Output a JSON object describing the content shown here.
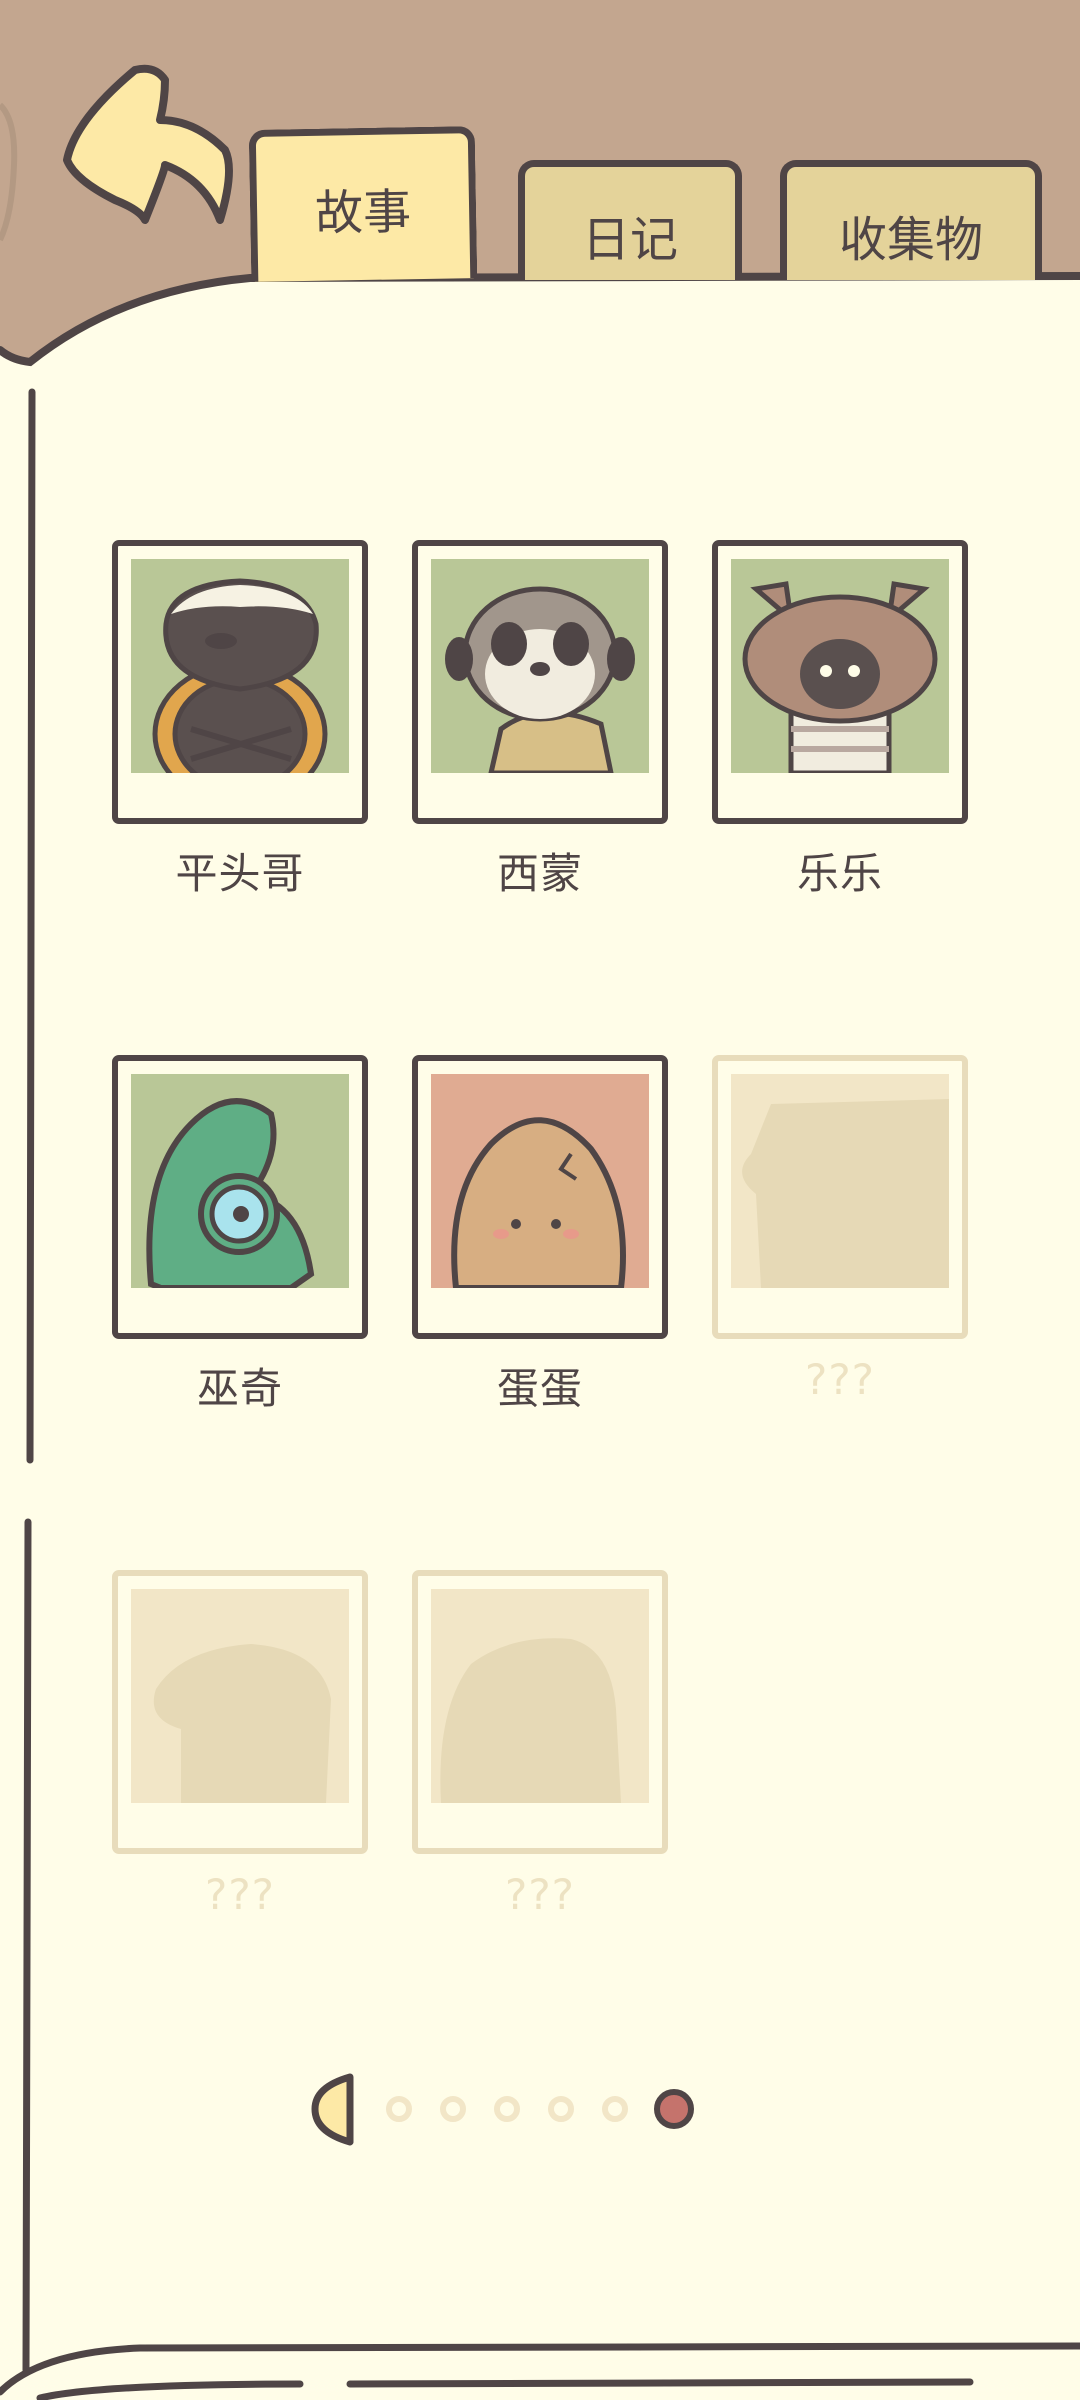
{
  "tabs": [
    {
      "label": "故事",
      "active": true
    },
    {
      "label": "日记",
      "active": false
    },
    {
      "label": "收集物",
      "active": false
    }
  ],
  "characters": [
    {
      "name": "平头哥",
      "unlocked": true,
      "bg": "#b9c797"
    },
    {
      "name": "西蒙",
      "unlocked": true,
      "bg": "#b9c797"
    },
    {
      "name": "乐乐",
      "unlocked": true,
      "bg": "#b9c797"
    },
    {
      "name": "巫奇",
      "unlocked": true,
      "bg": "#b9c797"
    },
    {
      "name": "蛋蛋",
      "unlocked": true,
      "bg": "#e0ab92"
    },
    {
      "name": "???",
      "unlocked": false
    },
    {
      "name": "???",
      "unlocked": false
    },
    {
      "name": "???",
      "unlocked": false
    }
  ],
  "pagination": {
    "pages": 6,
    "current": 6
  },
  "colors": {
    "header": "#c3a68f",
    "paper": "#fffde8",
    "outline": "#4f4546",
    "back_arrow": "#fde9a6",
    "active_dot": "#c5736c"
  }
}
